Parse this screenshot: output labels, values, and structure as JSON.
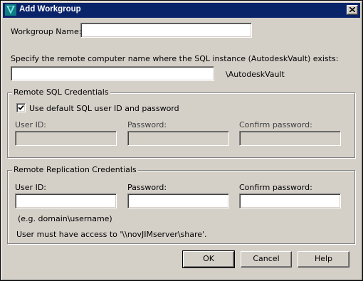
{
  "window": {
    "title": "Add Workgroup"
  },
  "workgroup": {
    "label": "Workgroup Name:",
    "value": ""
  },
  "remote": {
    "label": "Specify the remote computer name where the SQL instance (AutodeskVault) exists:",
    "value": "",
    "suffix": "\\AutodeskVault"
  },
  "sql_credentials": {
    "title": "Remote SQL Credentials",
    "checkbox_label": "Use default SQL user ID and password",
    "checkbox_checked": true,
    "user_id_label": "User ID:",
    "password_label": "Password:",
    "confirm_label": "Confirm password:"
  },
  "replication_credentials": {
    "title": "Remote Replication Credentials",
    "user_id_label": "User ID:",
    "password_label": "Password:",
    "confirm_label": "Confirm password:",
    "hint": "(e.g. domain\\username)",
    "access_note": "User must have access to '\\\\novJIMserver\\share'."
  },
  "buttons": {
    "ok": "OK",
    "cancel": "Cancel",
    "help": "Help"
  },
  "colors": {
    "titlebar": "#0a246a",
    "face": "#d4d0c8"
  }
}
